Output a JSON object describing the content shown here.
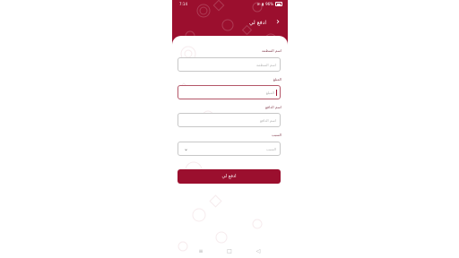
{
  "status_bar": {
    "time": "7:14",
    "battery": "96%"
  },
  "header": {
    "title": "ادفع لي",
    "back_icon": "chevron-right-icon"
  },
  "form": {
    "fields": [
      {
        "label": "اسم المنظمة",
        "placeholder": "اسم المنظمة"
      },
      {
        "label": "المبلغ",
        "placeholder": "المبلغ"
      },
      {
        "label": "اسم الدافع",
        "placeholder": "اسم الدافع"
      },
      {
        "label": "السبب",
        "placeholder": "السبب"
      }
    ],
    "submit_label": "ادفع لي"
  },
  "colors": {
    "brand": "#9b0f2e",
    "field_border": "#c7c7c7",
    "label": "#8b4a5a"
  },
  "navbar": {
    "icons": [
      "menu-icon",
      "home-icon",
      "back-icon"
    ]
  }
}
